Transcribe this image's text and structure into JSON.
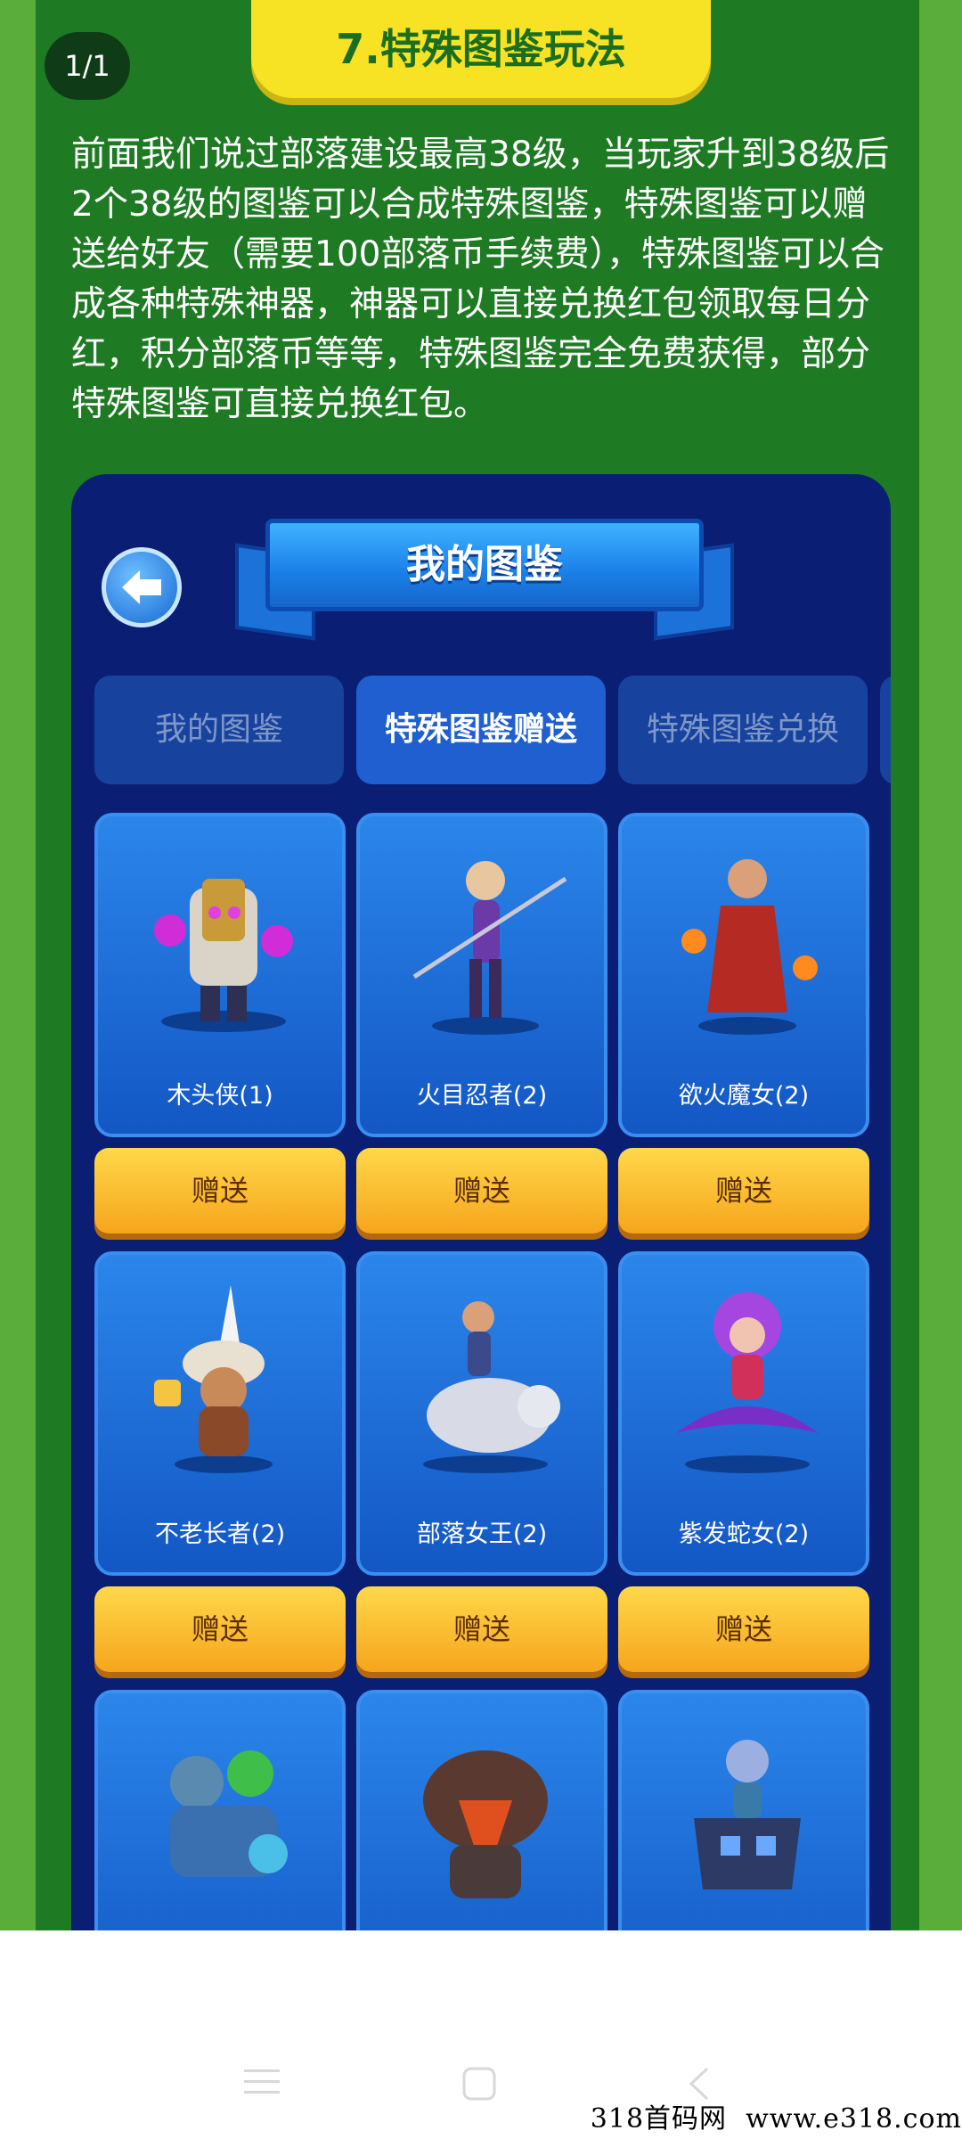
{
  "page": {
    "counter": "1/1",
    "section_title": "7.特殊图鉴玩法",
    "intro": "前面我们说过部落建设最高38级，当玩家升到38级后2个38级的图鉴可以合成特殊图鉴，特殊图鉴可以赠送给好友（需要100部落币手续费），特殊图鉴可以合成各种特殊神器，神器可以直接兑换红包领取每日分红，积分部落币等等，特殊图鉴完全免费获得，部分特殊图鉴可直接兑换红包。"
  },
  "game": {
    "header_title": "我的图鉴",
    "back_icon": "back-arrow-icon",
    "tabs": [
      {
        "label": "我的图鉴",
        "active": false
      },
      {
        "label": "特殊图鉴赠送",
        "active": true
      },
      {
        "label": "特殊图鉴兑换",
        "active": false
      }
    ],
    "cards": [
      {
        "name": "木头侠(1)",
        "button": "赠送",
        "accent": "#f5c542"
      },
      {
        "name": "火目忍者(2)",
        "button": "赠送",
        "accent": "#e0d0ff"
      },
      {
        "name": "欲火魔女(2)",
        "button": "赠送",
        "accent": "#c23a2a"
      },
      {
        "name": "不老长者(2)",
        "button": "赠送",
        "accent": "#f2f2f2"
      },
      {
        "name": "部落女王(2)",
        "button": "赠送",
        "accent": "#dcdde6"
      },
      {
        "name": "紫发蛇女(2)",
        "button": "赠送",
        "accent": "#9b3de0"
      },
      {
        "name": "",
        "button": "",
        "accent": "#3fbf4a"
      },
      {
        "name": "",
        "button": "",
        "accent": "#e0501e"
      },
      {
        "name": "",
        "button": "",
        "accent": "#6aa8ff"
      }
    ]
  },
  "system": {
    "watermark": "318首码网  www.e318.com",
    "nav_icons": [
      "menu-icon",
      "home-icon",
      "back-icon"
    ]
  },
  "colors": {
    "page_green": "#5aad3a",
    "panel_green": "#1e7a23",
    "title_yellow": "#f7e323",
    "game_bg": "#0a1f74",
    "gift_button": "#f6a51c"
  }
}
